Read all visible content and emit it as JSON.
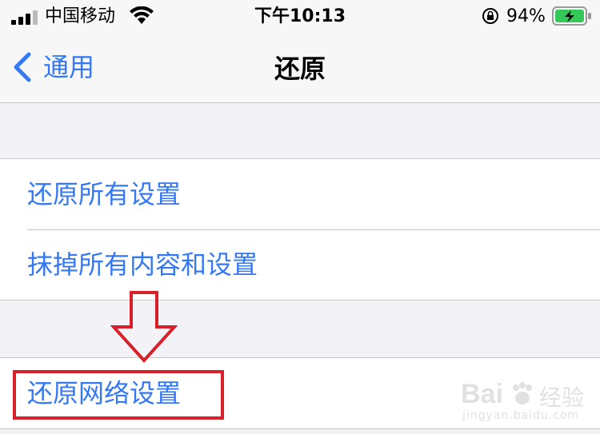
{
  "status_bar": {
    "carrier": "中国移动",
    "time": "下午10:13",
    "battery_percent": "94%",
    "icons": [
      "signal-icon",
      "wifi-icon",
      "orientation-lock-icon",
      "battery-charging-icon"
    ]
  },
  "nav": {
    "back_label": "通用",
    "title": "还原"
  },
  "groups": [
    {
      "items": [
        {
          "label": "还原所有设置"
        },
        {
          "label": "抹掉所有内容和设置"
        }
      ]
    },
    {
      "items": [
        {
          "label": "还原网络设置"
        }
      ]
    }
  ],
  "watermark": {
    "brand_latin": "Bai",
    "brand_cn": "经验",
    "url": "jingyan.baidu.com"
  },
  "colors": {
    "accent": "#3478f6",
    "annotation": "#d8202a",
    "background": "#f2f2f7",
    "battery_green": "#34c759"
  }
}
